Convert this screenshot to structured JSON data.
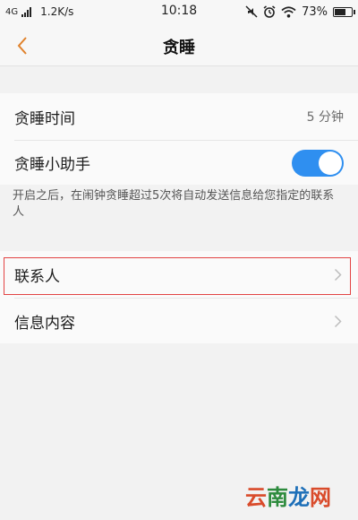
{
  "status_bar": {
    "network": "4G",
    "speed": "1.2K/s",
    "time": "10:18",
    "battery": "73%",
    "battery_level": 0.73
  },
  "nav": {
    "title": "贪睡",
    "accent_color": "#e0822c"
  },
  "settings": {
    "snooze_time_label": "贪睡时间",
    "snooze_time_value": "5 分钟",
    "assistant_label": "贪睡小助手",
    "assistant_enabled": true,
    "hint": "开启之后，在闹钟贪睡超过5次将自动发送信息给您指定的联系人",
    "contacts_label": "联系人",
    "message_label": "信息内容"
  },
  "watermark": {
    "chars": [
      "云",
      "南",
      "龙",
      "网"
    ]
  }
}
